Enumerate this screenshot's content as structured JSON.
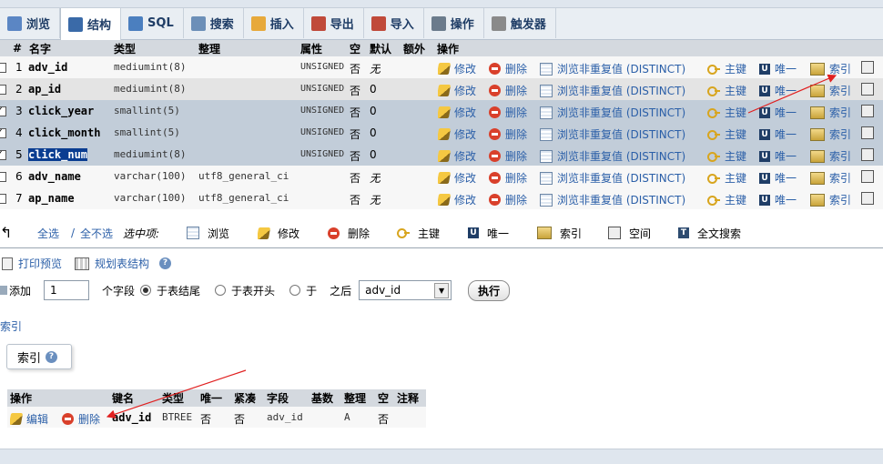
{
  "tabs": [
    {
      "label": "浏览",
      "icon": "table-icon",
      "color": "#5b86c4"
    },
    {
      "label": "结构",
      "icon": "structure-icon",
      "color": "#3a6aa8",
      "active": true
    },
    {
      "label": "SQL",
      "icon": "sql-icon",
      "color": "#4b7fbf"
    },
    {
      "label": "搜索",
      "icon": "search-icon",
      "color": "#6c8fb8"
    },
    {
      "label": "插入",
      "icon": "insert-icon",
      "color": "#e7a93b"
    },
    {
      "label": "导出",
      "icon": "export-icon",
      "color": "#c04a3a"
    },
    {
      "label": "导入",
      "icon": "import-icon",
      "color": "#c04a3a"
    },
    {
      "label": "操作",
      "icon": "wrench-icon",
      "color": "#6b7b8c"
    },
    {
      "label": "触发器",
      "icon": "trigger-icon",
      "color": "#8a8a8a"
    }
  ],
  "columns": {
    "num": "#",
    "name": "名字",
    "type": "类型",
    "collation": "整理",
    "attributes": "属性",
    "null": "空",
    "default": "默认",
    "extra": "额外",
    "action": "操作"
  },
  "actions": {
    "edit": "修改",
    "delete": "删除",
    "browse_distinct": "浏览非重复值 (DISTINCT)",
    "primary": "主键",
    "unique": "唯一",
    "index": "索引"
  },
  "rows": [
    {
      "num": "1",
      "name": "adv_id",
      "type": "mediumint(8)",
      "collation": "",
      "attributes": "UNSIGNED",
      "null": "否",
      "default": "无",
      "style": "odd",
      "checked": false
    },
    {
      "num": "2",
      "name": "ap_id",
      "type": "mediumint(8)",
      "collation": "",
      "attributes": "UNSIGNED",
      "null": "否",
      "default": "0",
      "style": "even",
      "checked": false
    },
    {
      "num": "3",
      "name": "click_year",
      "type": "smallint(5)",
      "collation": "",
      "attributes": "UNSIGNED",
      "null": "否",
      "default": "0",
      "style": "sel",
      "checked": true
    },
    {
      "num": "4",
      "name": "click_month",
      "type": "smallint(5)",
      "collation": "",
      "attributes": "UNSIGNED",
      "null": "否",
      "default": "0",
      "style": "sel",
      "checked": true
    },
    {
      "num": "5",
      "name": "click_num",
      "type": "mediumint(8)",
      "collation": "",
      "attributes": "UNSIGNED",
      "null": "否",
      "default": "0",
      "style": "sel",
      "checked": true,
      "highlight": true
    },
    {
      "num": "6",
      "name": "adv_name",
      "type": "varchar(100)",
      "collation": "utf8_general_ci",
      "attributes": "",
      "null": "否",
      "default": "无",
      "style": "odd",
      "checked": false
    },
    {
      "num": "7",
      "name": "ap_name",
      "type": "varchar(100)",
      "collation": "utf8_general_ci",
      "attributes": "",
      "null": "否",
      "default": "无",
      "style": "odd",
      "checked": false
    }
  ],
  "bulk": {
    "check_all": "全选",
    "separator": "/",
    "uncheck_all": "全不选",
    "with_selected": "选中项:",
    "browse": "浏览",
    "edit": "修改",
    "delete": "删除",
    "primary": "主键",
    "unique": "唯一",
    "index": "索引",
    "spatial": "空间",
    "fulltext": "全文搜索"
  },
  "tools": {
    "print_view": "打印预览",
    "relation_view": "规划表结构"
  },
  "add": {
    "label": "添加",
    "count": "1",
    "fields_label": "个字段",
    "at_end": "于表结尾",
    "at_beginning": "于表开头",
    "after_prefix": "于",
    "after": "之后",
    "after_field": "adv_id",
    "go": "执行"
  },
  "index_link": "索引",
  "indexes": {
    "legend": "索引",
    "headers": {
      "action": "操作",
      "keyname": "键名",
      "type": "类型",
      "unique": "唯一",
      "packed": "紧凑",
      "field": "字段",
      "cardinality": "基数",
      "collation": "整理",
      "null": "空",
      "comment": "注释"
    },
    "edit": "编辑",
    "delete": "删除",
    "rows": [
      {
        "keyname": "adv_id",
        "type": "BTREE",
        "unique": "否",
        "packed": "否",
        "field": "adv_id",
        "cardinality": "",
        "collation": "A",
        "null": "否",
        "comment": ""
      }
    ]
  }
}
